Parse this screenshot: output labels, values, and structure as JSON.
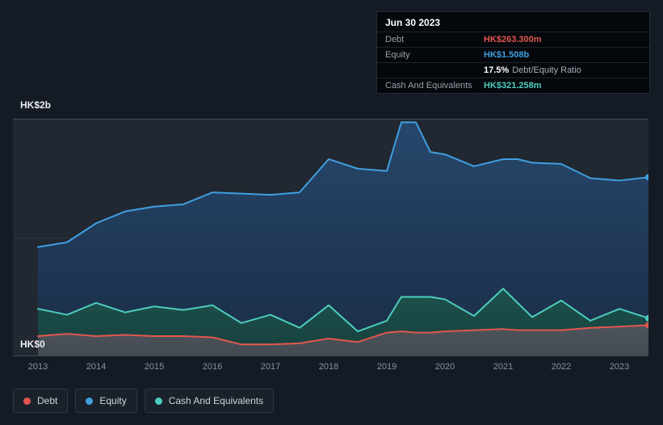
{
  "tooltip": {
    "date": "Jun 30 2023",
    "debt_label": "Debt",
    "debt_value": "HK$263.300m",
    "equity_label": "Equity",
    "equity_value": "HK$1.508b",
    "ratio_value": "17.5%",
    "ratio_text": "Debt/Equity Ratio",
    "cash_label": "Cash And Equivalents",
    "cash_value": "HK$321.258m"
  },
  "chart_data": {
    "type": "area",
    "y_top_label": "HK$2b",
    "y_bottom_label": "HK$0",
    "y_unit": "HK$ billions",
    "ylim": [
      0,
      2
    ],
    "grid": true,
    "legend_position": "bottom-left",
    "x_ticks": [
      2013,
      2014,
      2015,
      2016,
      2017,
      2018,
      2019,
      2020,
      2021,
      2022,
      2023
    ],
    "x": [
      2013,
      2013.5,
      2014,
      2014.5,
      2015,
      2015.5,
      2016,
      2016.5,
      2017,
      2017.5,
      2018,
      2018.5,
      2019,
      2019.25,
      2019.5,
      2019.75,
      2020,
      2020.5,
      2021,
      2021.25,
      2021.5,
      2022,
      2022.5,
      2023,
      2023.5
    ],
    "series": [
      {
        "name": "Debt",
        "slug": "debt",
        "color": "#e2574f",
        "fill_top": "#4e545c",
        "fill_bottom": "#444a52",
        "values": [
          0.17,
          0.19,
          0.17,
          0.18,
          0.17,
          0.17,
          0.16,
          0.1,
          0.1,
          0.11,
          0.15,
          0.12,
          0.2,
          0.21,
          0.2,
          0.2,
          0.21,
          0.22,
          0.23,
          0.22,
          0.22,
          0.22,
          0.24,
          0.25,
          0.263
        ]
      },
      {
        "name": "Equity",
        "slug": "equity",
        "color": "#3f9fe0",
        "fill_top": "#27476b",
        "fill_bottom": "#1a2d46",
        "values": [
          0.92,
          0.96,
          1.12,
          1.22,
          1.26,
          1.28,
          1.38,
          1.37,
          1.36,
          1.38,
          1.66,
          1.58,
          1.56,
          1.97,
          1.97,
          1.72,
          1.7,
          1.6,
          1.66,
          1.66,
          1.63,
          1.62,
          1.5,
          1.48,
          1.508
        ]
      },
      {
        "name": "Cash And Equivalents",
        "slug": "cash",
        "color": "#4ccdbd",
        "fill_top": "#1d524d",
        "fill_bottom": "#173f3d",
        "values": [
          0.4,
          0.35,
          0.45,
          0.37,
          0.42,
          0.39,
          0.43,
          0.28,
          0.35,
          0.24,
          0.43,
          0.21,
          0.3,
          0.5,
          0.5,
          0.5,
          0.48,
          0.34,
          0.57,
          0.45,
          0.33,
          0.47,
          0.3,
          0.4,
          0.321
        ]
      }
    ]
  }
}
